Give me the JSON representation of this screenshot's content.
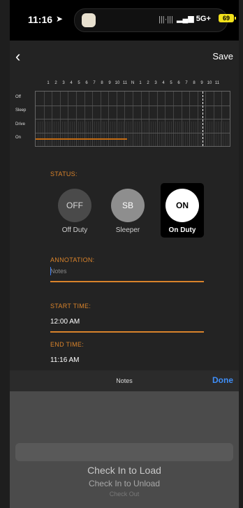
{
  "status_bar": {
    "time": "11:16",
    "location_arrow": "➤",
    "audio_wave_icon": "audio-waveform-icon",
    "network": "5G+",
    "battery": "69",
    "battery_color": "#f2e11b"
  },
  "header": {
    "back_icon": "chevron-left-icon",
    "back_glyph": "‹",
    "save_label": "Save"
  },
  "log_graph": {
    "hour_labels": [
      "1",
      "2",
      "3",
      "4",
      "5",
      "6",
      "7",
      "8",
      "9",
      "10",
      "11",
      "N",
      "1",
      "2",
      "3",
      "4",
      "5",
      "6",
      "7",
      "8",
      "9",
      "10",
      "11"
    ],
    "rows": [
      "Off",
      "Sleep",
      "Drive",
      "On"
    ],
    "on_duty_until_hour": 11.27,
    "current_time_hour": 20.6,
    "accent_color": "#c46b12"
  },
  "status": {
    "label": "STATUS:",
    "options": [
      {
        "short": "OFF",
        "name": "Off Duty",
        "selected": false
      },
      {
        "short": "SB",
        "name": "Sleeper",
        "selected": false
      },
      {
        "short": "ON",
        "name": "On Duty",
        "selected": true
      }
    ]
  },
  "annotation": {
    "label": "ANNOTATION:",
    "placeholder": "Notes",
    "value": ""
  },
  "start_time": {
    "label": "START TIME:",
    "value": "12:00 AM"
  },
  "end_time": {
    "label": "END TIME:",
    "value": "11:16 AM"
  },
  "keyboard_toolbar": {
    "title": "Notes",
    "done_label": "Done"
  },
  "picker": {
    "items": [
      "Check In to Load",
      "Check In to Unload",
      "Check Out"
    ]
  },
  "colors": {
    "accent": "#d9832b",
    "link": "#3f8ef7"
  }
}
